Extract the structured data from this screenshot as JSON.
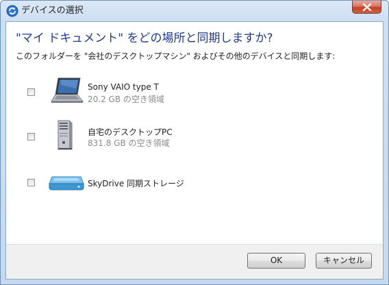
{
  "window": {
    "title": "デバイスの選択",
    "close_label": "Close"
  },
  "dialog": {
    "heading": "\"マイ ドキュメント\" をどの場所と同期しますか?",
    "description": "このフォルダーを \"会社のデスクトップマシン\" およびその他のデバイスと同期します:"
  },
  "devices": [
    {
      "name": "Sony VAIO type T",
      "space": "20.2 GB の空き領域",
      "icon": "laptop-icon",
      "checked": false
    },
    {
      "name": "自宅のデスクトップPC",
      "space": "831.8 GB の空き領域",
      "icon": "desktop-tower-icon",
      "checked": false
    },
    {
      "name": "SkyDrive 同期ストレージ",
      "icon": "cloud-storage-icon",
      "checked": false
    }
  ],
  "buttons": {
    "ok": "OK",
    "cancel": "キャンセル"
  },
  "colors": {
    "heading": "#1f3b8a",
    "secondary_text": "#8a8a8a",
    "footer_bg": "#f0f0f0",
    "close_button": "#c4412a"
  }
}
